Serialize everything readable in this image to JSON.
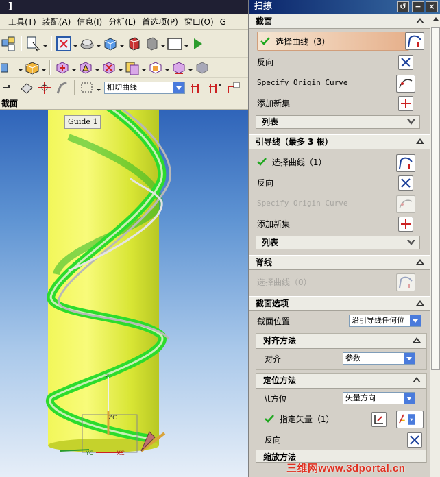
{
  "app": {
    "title_fragment": "]",
    "menu": [
      "工具(T)",
      "装配(A)",
      "信息(I)",
      "分析(L)",
      "首选项(P)",
      "窗口(O)",
      "G"
    ],
    "curve_rule_value": "相切曲线",
    "section_title": "截面",
    "guide_tag": "Guide 1",
    "axes": {
      "z_label": "Z",
      "zc_label": "ZC",
      "yc_label": "YC",
      "xc_label": "XC"
    }
  },
  "dialog": {
    "title": "扫掠",
    "sections": {
      "header": "截面",
      "select_curve": "选择曲线（3）",
      "reverse": "反向",
      "specify_origin": "Specify Origin Curve",
      "add_new_set": "添加新集",
      "list": "列表"
    },
    "guides": {
      "header": "引导线（最多 3 根）",
      "select_curve": "选择曲线（1）",
      "reverse": "反向",
      "specify_origin": "Specify Origin Curve",
      "add_new_set": "添加新集",
      "list": "列表"
    },
    "spine": {
      "header": "脊线",
      "select_curve": "选择曲线（0）"
    },
    "section_options": {
      "header": "截面选项",
      "position_label": "截面位置",
      "position_value": "沿引导线任何位",
      "alignment": {
        "header": "对齐方法",
        "label": "对齐",
        "value": "参数"
      },
      "orientation": {
        "header": "定位方法",
        "label": "\\t方位",
        "value": "矢量方向",
        "specify_vector": "指定矢量（1）",
        "reverse": "反向"
      },
      "cut_off_header": "缩放方法"
    }
  },
  "watermark": "三维网www.3dportal.cn",
  "colors": {
    "accent_orange": "#e6b08b",
    "check_green": "#1fa81f",
    "cylinder": "#e3f23a",
    "helix": "#2cdc2c"
  }
}
